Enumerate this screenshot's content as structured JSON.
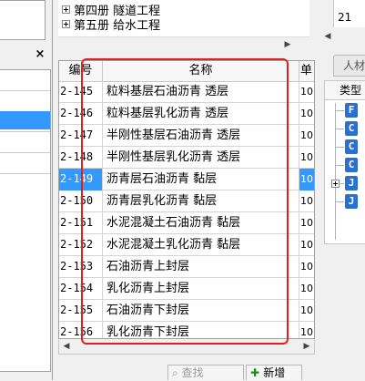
{
  "tree": {
    "items": [
      {
        "label": "第四册 隧道工程"
      },
      {
        "label": "第五册 给水工程"
      }
    ]
  },
  "left_panel": {
    "close_glyph": "×"
  },
  "quota_grid": {
    "columns": {
      "code": "编号",
      "name": "名称",
      "unit": "单"
    },
    "rows": [
      {
        "code": "2-145",
        "name": "粒料基层石油沥青 透层",
        "unit": "10"
      },
      {
        "code": "2-146",
        "name": "粒料基层乳化沥青 透层",
        "unit": "10"
      },
      {
        "code": "2-147",
        "name": "半刚性基层石油沥青 透层",
        "unit": "10"
      },
      {
        "code": "2-148",
        "name": "半刚性基层乳化沥青 透层",
        "unit": "10"
      },
      {
        "code": "2-149",
        "name": "沥青层石油沥青 黏层",
        "unit": "10",
        "selected": true
      },
      {
        "code": "2-150",
        "name": "沥青层乳化沥青 黏层",
        "unit": "10"
      },
      {
        "code": "2-151",
        "name": "水泥混凝土石油沥青 黏层",
        "unit": "10"
      },
      {
        "code": "2-152",
        "name": "水泥混凝土乳化沥青 黏层",
        "unit": "10"
      },
      {
        "code": "2-153",
        "name": "石油沥青上封层",
        "unit": "10"
      },
      {
        "code": "2-154",
        "name": "乳化沥青上封层",
        "unit": "10"
      },
      {
        "code": "2-155",
        "name": "石油沥青下封层",
        "unit": "10"
      },
      {
        "code": "2-156",
        "name": "乳化沥青下封层",
        "unit": "10"
      }
    ]
  },
  "toolbar": {
    "find_label": "查找",
    "new_label": "新增"
  },
  "right_panel": {
    "top_value": "21",
    "tab_label": "人材",
    "type_header": "类型",
    "type_rows": [
      {
        "badge": "F"
      },
      {
        "badge": "C"
      },
      {
        "badge": "C"
      },
      {
        "badge": "C"
      },
      {
        "badge": "J",
        "expandable": true
      },
      {
        "badge": "J"
      }
    ]
  },
  "colors": {
    "selection": "#3399ff",
    "highlight_box": "#e02020",
    "type_badge": "#2b6fcf"
  }
}
